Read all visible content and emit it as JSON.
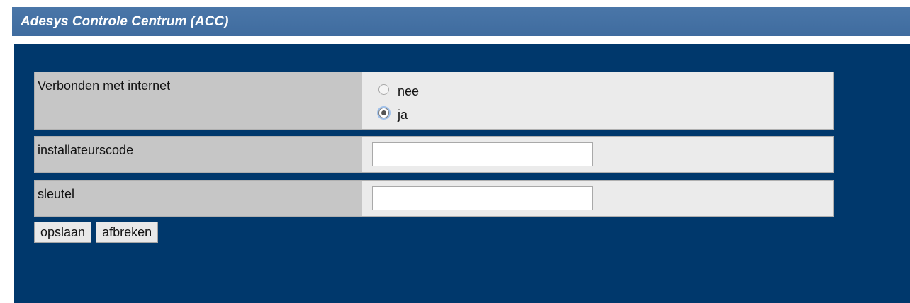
{
  "app": {
    "title": "Adesys Controle Centrum (ACC)"
  },
  "form": {
    "connected": {
      "label": "Verbonden met internet",
      "options": [
        {
          "label": "nee",
          "checked": false
        },
        {
          "label": "ja",
          "checked": true
        }
      ]
    },
    "installer_code": {
      "label": "installateurscode",
      "value": ""
    },
    "key": {
      "label": "sleutel",
      "value": ""
    }
  },
  "buttons": {
    "save": "opslaan",
    "cancel": "afbreken"
  },
  "colors": {
    "titlebar": "#4a76a8",
    "panel_background": "#00386c",
    "label_cell": "#c6c6c6",
    "row_background": "#ebebeb"
  }
}
